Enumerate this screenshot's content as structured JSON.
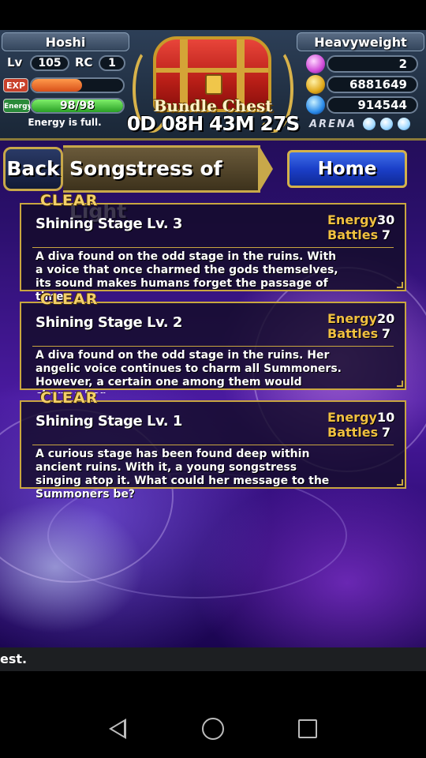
{
  "hud": {
    "player_name": "Hoshi",
    "title": "Heavyweight",
    "lv_label": "Lv",
    "lv_value": "105",
    "rc_label": "RC",
    "rc_value": "1",
    "exp_label": "EXP",
    "exp_fraction": 0.55,
    "energy_label": "Energy",
    "energy_value": "98/98",
    "energy_fraction": 1.0,
    "energy_status": "Energy is full.",
    "gems": "2",
    "zel": "6881649",
    "karma": "914544",
    "arena_label": "ARENA",
    "arena_orbs": 3
  },
  "chest": {
    "title": "Bundle Chest",
    "timer": "0D 08H 43M 27S"
  },
  "nav": {
    "back_label": "Back",
    "page_title": "Songstress of Light",
    "home_label": "Home"
  },
  "stages": [
    {
      "clear": "CLEAR",
      "name": "Shining Stage Lv. 3",
      "energy_label": "Energy",
      "energy": "30",
      "battles_label": "Battles",
      "battles": "7",
      "desc": "A diva found on the odd stage in the ruins. With a voice that once charmed the gods themselves, its sound makes humans forget the passage of time."
    },
    {
      "clear": "CLEAR",
      "name": "Shining Stage Lv. 2",
      "energy_label": "Energy",
      "energy": "20",
      "battles_label": "Battles",
      "battles": "7",
      "desc": "A diva found on the odd stage in the ruins. Her angelic voice continues to charm all Summoners. However, a certain one among them would change her..."
    },
    {
      "clear": "CLEAR",
      "name": "Shining Stage Lv. 1",
      "energy_label": "Energy",
      "energy": "10",
      "battles_label": "Battles",
      "battles": "7",
      "desc": "A curious stage has been found deep within ancient ruins. With it, a young songstress singing atop it. What could her message to the Summoners be?"
    }
  ],
  "ticker": {
    "text": "est."
  },
  "colors": {
    "gold_border": "#c9a640",
    "exp_bar": "#e8662a",
    "energy_bar": "#3ec43a",
    "home_button": "#1b3fc8"
  }
}
